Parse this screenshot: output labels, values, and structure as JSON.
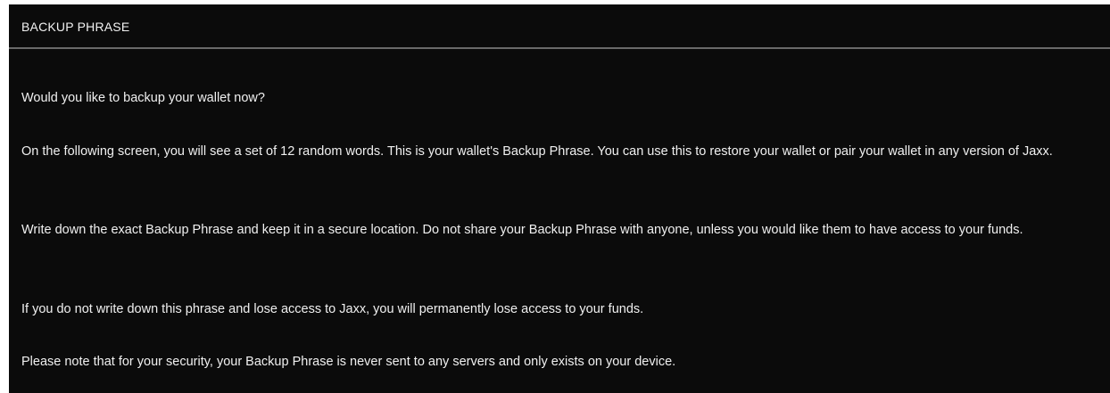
{
  "dialog": {
    "title": "BACKUP PHRASE",
    "question": "Would you like to backup your wallet now?",
    "paragraphs": [
      "On the following screen, you will see a set of 12 random words. This is your wallet's Backup Phrase. You can use this to restore your wallet or pair your wallet in any version of Jaxx.",
      "Write down the exact Backup Phrase and keep it in a secure location. Do not share your Backup Phrase with anyone, unless you would like them to have access to your funds.",
      "If you do not write down this phrase and lose access to Jaxx, you will permanently lose access to your funds.",
      "Please note that for your security, your Backup Phrase is never sent to any servers and only exists on your device."
    ]
  },
  "colors": {
    "background": "#0b0b0b",
    "text": "#f0f0f0",
    "divider": "#6a6a6a"
  }
}
